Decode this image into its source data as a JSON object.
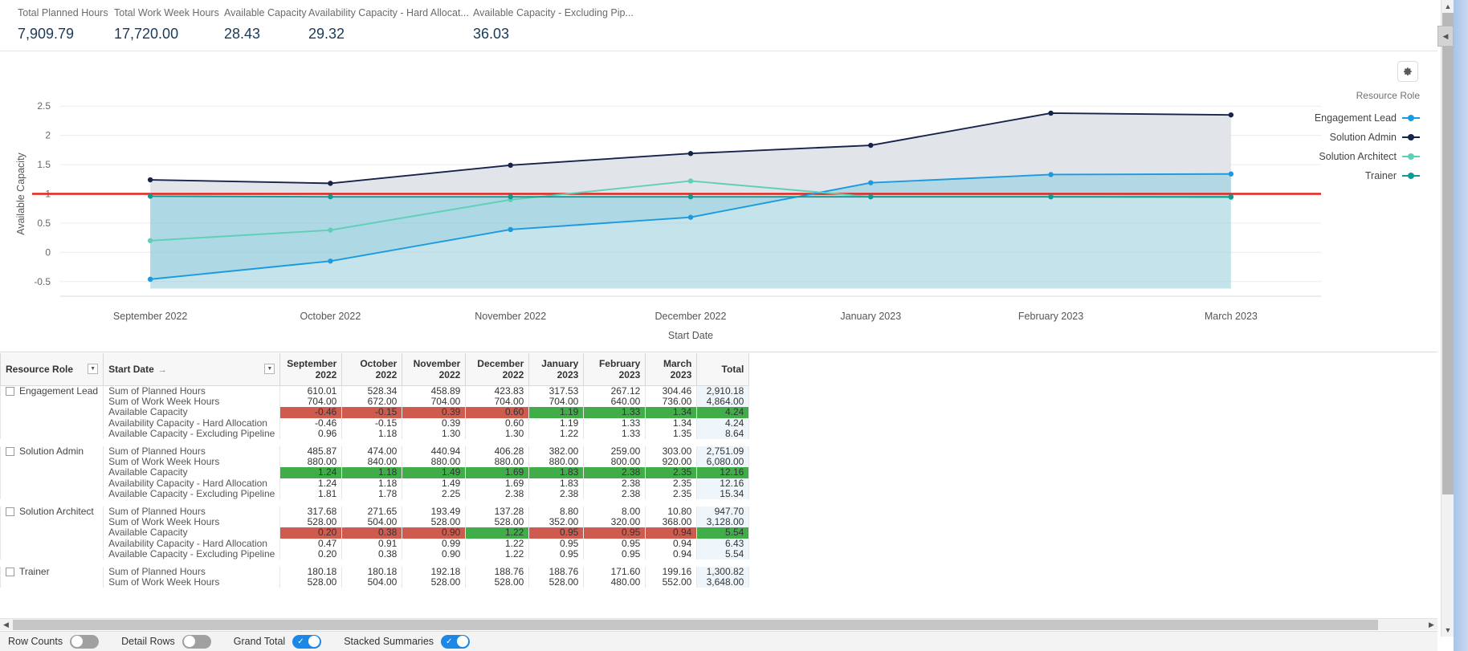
{
  "kpis": [
    {
      "label": "Total Planned Hours",
      "value": "7,909.79"
    },
    {
      "label": "Total Work Week Hours",
      "value": "17,720.00"
    },
    {
      "label": "Available Capacity",
      "value": "28.43"
    },
    {
      "label": "Availability Capacity - Hard Allocat...",
      "value": "29.32"
    },
    {
      "label": "Available Capacity - Excluding Pip...",
      "value": "36.03"
    }
  ],
  "chart_toolbar": {
    "settings_icon": "gear-icon"
  },
  "legend": {
    "title": "Resource Role",
    "items": [
      {
        "label": "Engagement Lead",
        "color": "#1b9ae0"
      },
      {
        "label": "Solution Admin",
        "color": "#16234a"
      },
      {
        "label": "Solution Architect",
        "color": "#5fd0b6"
      },
      {
        "label": "Trainer",
        "color": "#119a94"
      }
    ]
  },
  "chart_data": {
    "type": "line",
    "title": "",
    "xlabel": "Start Date",
    "ylabel": "Available Capacity",
    "ylim": [
      -0.75,
      2.75
    ],
    "yticks": [
      -0.5,
      0,
      0.5,
      1,
      1.5,
      2,
      2.5
    ],
    "ytick_labels": [
      "-0.5",
      "0",
      "0.5",
      "1",
      "1.5",
      "2",
      "2.5"
    ],
    "grid": true,
    "legend_position": "right",
    "categories": [
      "September 2022",
      "October 2022",
      "November 2022",
      "December 2022",
      "January 2023",
      "February 2023",
      "March 2023"
    ],
    "reference_line": {
      "value": 1,
      "color": "#e8231a",
      "label": ""
    },
    "series": [
      {
        "name": "Engagement Lead",
        "color": "#1b9ae0",
        "values": [
          -0.46,
          -0.15,
          0.39,
          0.6,
          1.19,
          1.33,
          1.34
        ]
      },
      {
        "name": "Solution Admin",
        "color": "#16234a",
        "values": [
          1.24,
          1.18,
          1.49,
          1.69,
          1.83,
          2.38,
          2.35
        ]
      },
      {
        "name": "Solution Architect",
        "color": "#5fd0b6",
        "values": [
          0.2,
          0.38,
          0.9,
          1.22,
          0.95,
          0.95,
          0.94
        ]
      },
      {
        "name": "Trainer",
        "color": "#119a94",
        "values": [
          0.96,
          0.95,
          0.95,
          0.95,
          0.95,
          0.95,
          0.95
        ]
      }
    ]
  },
  "table": {
    "headers": [
      "Resource Role",
      "Start Date",
      "September 2022",
      "October 2022",
      "November 2022",
      "December 2022",
      "January 2023",
      "February 2023",
      "March 2023",
      "Total"
    ],
    "sort_indicator": "→",
    "filter_icon": "filter-dropdown-icon",
    "groups": [
      {
        "role": "Engagement Lead",
        "rows": [
          {
            "measure": "Sum of Planned Hours",
            "values": [
              "610.01",
              "528.34",
              "458.89",
              "423.83",
              "317.53",
              "267.12",
              "304.46"
            ],
            "total": "2,910.18",
            "fills": [
              "",
              "",
              "",
              "",
              "",
              "",
              ""
            ],
            "total_fill": ""
          },
          {
            "measure": "Sum of Work Week Hours",
            "values": [
              "704.00",
              "672.00",
              "704.00",
              "704.00",
              "704.00",
              "640.00",
              "736.00"
            ],
            "total": "4,864.00",
            "fills": [
              "",
              "",
              "",
              "",
              "",
              "",
              ""
            ],
            "total_fill": ""
          },
          {
            "measure": "Available Capacity",
            "values": [
              "-0.46",
              "-0.15",
              "0.39",
              "0.60",
              "1.19",
              "1.33",
              "1.34"
            ],
            "total": "4.24",
            "fills": [
              "red",
              "red",
              "red",
              "red",
              "green",
              "green",
              "green"
            ],
            "total_fill": "green"
          },
          {
            "measure": "Availability Capacity - Hard Allocation",
            "values": [
              "-0.46",
              "-0.15",
              "0.39",
              "0.60",
              "1.19",
              "1.33",
              "1.34"
            ],
            "total": "4.24",
            "fills": [
              "",
              "",
              "",
              "",
              "",
              "",
              ""
            ],
            "total_fill": ""
          },
          {
            "measure": "Available Capacity - Excluding Pipeline",
            "values": [
              "0.96",
              "1.18",
              "1.30",
              "1.30",
              "1.22",
              "1.33",
              "1.35"
            ],
            "total": "8.64",
            "fills": [
              "",
              "",
              "",
              "",
              "",
              "",
              ""
            ],
            "total_fill": ""
          }
        ]
      },
      {
        "role": "Solution Admin",
        "rows": [
          {
            "measure": "Sum of Planned Hours",
            "values": [
              "485.87",
              "474.00",
              "440.94",
              "406.28",
              "382.00",
              "259.00",
              "303.00"
            ],
            "total": "2,751.09",
            "fills": [
              "",
              "",
              "",
              "",
              "",
              "",
              ""
            ],
            "total_fill": ""
          },
          {
            "measure": "Sum of Work Week Hours",
            "values": [
              "880.00",
              "840.00",
              "880.00",
              "880.00",
              "880.00",
              "800.00",
              "920.00"
            ],
            "total": "6,080.00",
            "fills": [
              "",
              "",
              "",
              "",
              "",
              "",
              ""
            ],
            "total_fill": ""
          },
          {
            "measure": "Available Capacity",
            "values": [
              "1.24",
              "1.18",
              "1.49",
              "1.69",
              "1.83",
              "2.38",
              "2.35"
            ],
            "total": "12.16",
            "fills": [
              "green",
              "green",
              "green",
              "green",
              "green",
              "green",
              "green"
            ],
            "total_fill": "green"
          },
          {
            "measure": "Availability Capacity - Hard Allocation",
            "values": [
              "1.24",
              "1.18",
              "1.49",
              "1.69",
              "1.83",
              "2.38",
              "2.35"
            ],
            "total": "12.16",
            "fills": [
              "",
              "",
              "",
              "",
              "",
              "",
              ""
            ],
            "total_fill": ""
          },
          {
            "measure": "Available Capacity - Excluding Pipeline",
            "values": [
              "1.81",
              "1.78",
              "2.25",
              "2.38",
              "2.38",
              "2.38",
              "2.35"
            ],
            "total": "15.34",
            "fills": [
              "",
              "",
              "",
              "",
              "",
              "",
              ""
            ],
            "total_fill": ""
          }
        ]
      },
      {
        "role": "Solution Architect",
        "rows": [
          {
            "measure": "Sum of Planned Hours",
            "values": [
              "317.68",
              "271.65",
              "193.49",
              "137.28",
              "8.80",
              "8.00",
              "10.80"
            ],
            "total": "947.70",
            "fills": [
              "",
              "",
              "",
              "",
              "",
              "",
              ""
            ],
            "total_fill": ""
          },
          {
            "measure": "Sum of Work Week Hours",
            "values": [
              "528.00",
              "504.00",
              "528.00",
              "528.00",
              "352.00",
              "320.00",
              "368.00"
            ],
            "total": "3,128.00",
            "fills": [
              "",
              "",
              "",
              "",
              "",
              "",
              ""
            ],
            "total_fill": ""
          },
          {
            "measure": "Available Capacity",
            "values": [
              "0.20",
              "0.38",
              "0.90",
              "1.22",
              "0.95",
              "0.95",
              "0.94"
            ],
            "total": "5.54",
            "fills": [
              "red",
              "red",
              "red",
              "green",
              "red",
              "red",
              "red"
            ],
            "total_fill": "green"
          },
          {
            "measure": "Availability Capacity - Hard Allocation",
            "values": [
              "0.47",
              "0.91",
              "0.99",
              "1.22",
              "0.95",
              "0.95",
              "0.94"
            ],
            "total": "6.43",
            "fills": [
              "",
              "",
              "",
              "",
              "",
              "",
              ""
            ],
            "total_fill": ""
          },
          {
            "measure": "Available Capacity - Excluding Pipeline",
            "values": [
              "0.20",
              "0.38",
              "0.90",
              "1.22",
              "0.95",
              "0.95",
              "0.94"
            ],
            "total": "5.54",
            "fills": [
              "",
              "",
              "",
              "",
              "",
              "",
              ""
            ],
            "total_fill": ""
          }
        ]
      },
      {
        "role": "Trainer",
        "rows": [
          {
            "measure": "Sum of Planned Hours",
            "values": [
              "180.18",
              "180.18",
              "192.18",
              "188.76",
              "188.76",
              "171.60",
              "199.16"
            ],
            "total": "1,300.82",
            "fills": [
              "",
              "",
              "",
              "",
              "",
              "",
              ""
            ],
            "total_fill": ""
          },
          {
            "measure": "Sum of Work Week Hours",
            "values": [
              "528.00",
              "504.00",
              "528.00",
              "528.00",
              "528.00",
              "480.00",
              "552.00"
            ],
            "total": "3,648.00",
            "fills": [
              "",
              "",
              "",
              "",
              "",
              "",
              ""
            ],
            "total_fill": ""
          }
        ]
      }
    ]
  },
  "footer": {
    "toggles": [
      {
        "label": "Row Counts",
        "on": false
      },
      {
        "label": "Detail Rows",
        "on": false
      },
      {
        "label": "Grand Total",
        "on": true
      },
      {
        "label": "Stacked Summaries",
        "on": true
      }
    ]
  },
  "scrollbars": {
    "up_arrow": "chevron-up-icon",
    "down_arrow": "chevron-down-icon",
    "left_arrow": "chevron-left-icon",
    "right_arrow": "chevron-right-icon",
    "collapse": "collapse-panel-icon"
  }
}
